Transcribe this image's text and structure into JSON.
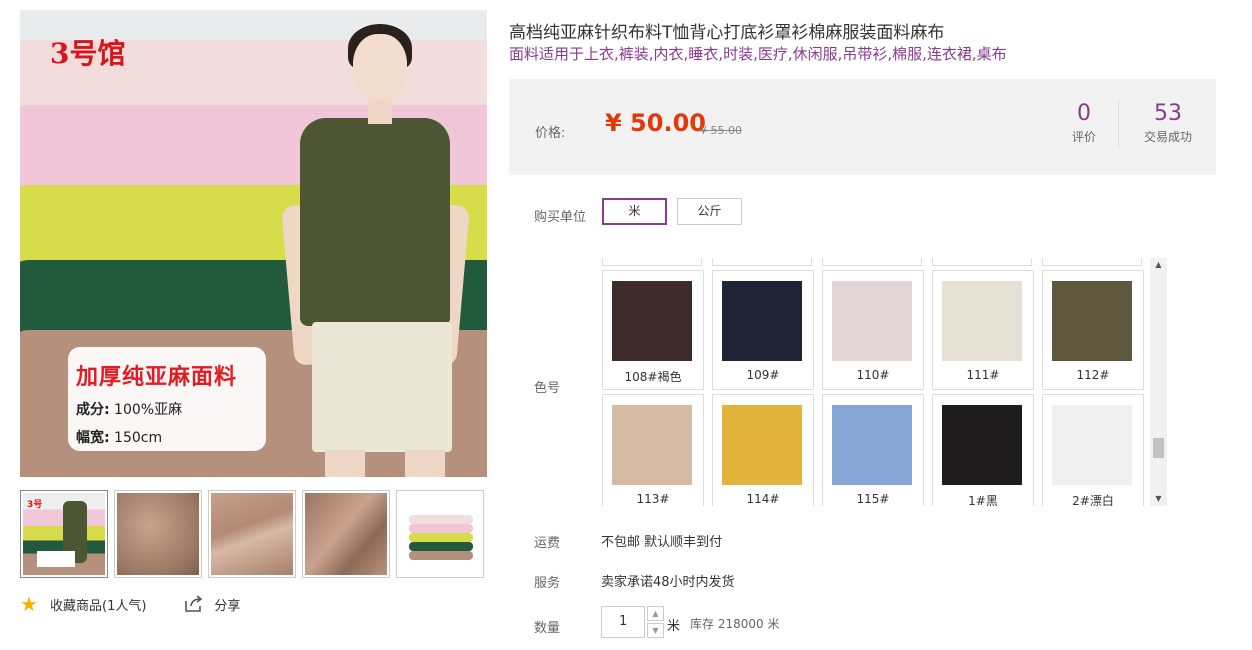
{
  "product": {
    "title": "高档纯亚麻针织布料T恤背心打底衫罩衫棉麻服装面料麻布",
    "subtitle": "面料适用于上衣,裤装,内衣,睡衣,时装,医疗,休闲服,吊带衫,棉服,连衣裙,桌布"
  },
  "main_image": {
    "logo_text": "3号馆",
    "promo_title": "加厚纯亚麻面料",
    "promo_composition_label": "成分:",
    "promo_composition_value": " 100%亚麻",
    "promo_width_label": "幅宽:",
    "promo_width_value": " 150cm"
  },
  "thumbnails": [
    "model",
    "fabric-fold-1",
    "fabric-fold-2",
    "fabric-fold-3",
    "fabric-stack"
  ],
  "actions": {
    "favorite_label": "收藏商品(1人气)",
    "share_label": "分享",
    "favorite_icon": "star-icon",
    "share_icon": "share-icon"
  },
  "price": {
    "label": "价格:",
    "current": "¥ 50.00",
    "original": "¥ 55.00",
    "reviews_count": "0",
    "reviews_label": "评价",
    "sales_count": "53",
    "sales_label": "交易成功",
    "accent_color": "#e4380a",
    "brand_color": "#8a3a8f"
  },
  "purchase_unit": {
    "label": "购买单位",
    "options": [
      "米",
      "公斤"
    ],
    "selected": "米"
  },
  "color": {
    "label": "色号",
    "swatches": [
      {
        "name": "108#褐色",
        "color": "#3d2c29"
      },
      {
        "name": "109#",
        "color": "#1f2434"
      },
      {
        "name": "110#",
        "color": "#e3d6d7"
      },
      {
        "name": "111#",
        "color": "#e5e2d4"
      },
      {
        "name": "112#",
        "color": "#5f5640"
      },
      {
        "name": "113#",
        "color": "#d5bba3"
      },
      {
        "name": "114#",
        "color": "#e1b33a"
      },
      {
        "name": "115#",
        "color": "#86a7d6"
      },
      {
        "name": "1#黑",
        "color": "#1e1c1d"
      },
      {
        "name": "2#漂白",
        "color": "#f0f0f0"
      }
    ]
  },
  "shipping": {
    "label": "运费",
    "value": "不包邮 默认顺丰到付"
  },
  "service": {
    "label": "服务",
    "value": "卖家承诺48小时内发货"
  },
  "quantity": {
    "label": "数量",
    "value": "1",
    "unit": "米",
    "stock": "库存 218000 米"
  }
}
